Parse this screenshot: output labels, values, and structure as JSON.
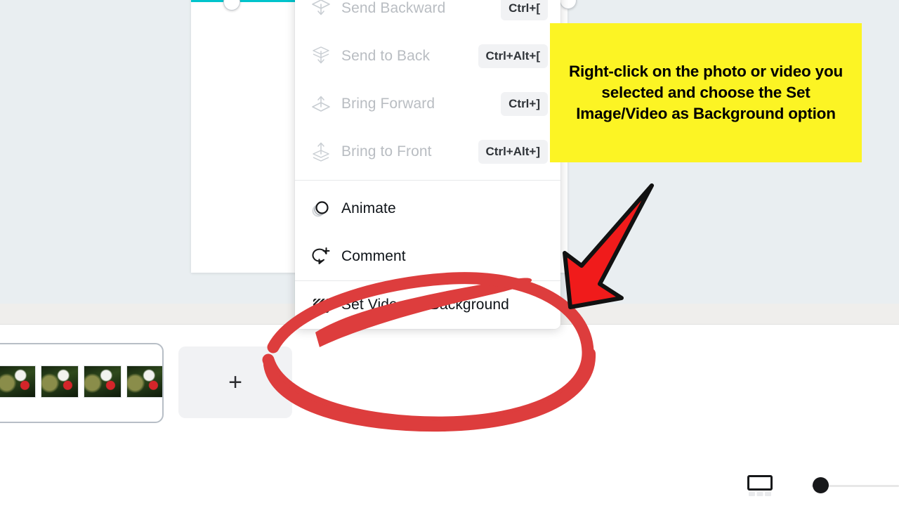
{
  "app": {
    "name": "canva-editor",
    "canvas_background_color": "#e9eef1",
    "selection_color": "#00c4cc"
  },
  "context_menu": {
    "items": [
      {
        "label": "Send Backward",
        "shortcut": "Ctrl+[",
        "icon": "send-backward-icon",
        "disabled": true
      },
      {
        "label": "Send to Back",
        "shortcut": "Ctrl+Alt+[",
        "icon": "send-to-back-icon",
        "disabled": true
      },
      {
        "label": "Bring Forward",
        "shortcut": "Ctrl+]",
        "icon": "bring-forward-icon",
        "disabled": true
      },
      {
        "label": "Bring to Front",
        "shortcut": "Ctrl+Alt+]",
        "icon": "bring-to-front-icon",
        "disabled": true
      },
      {
        "label": "Animate",
        "shortcut": "",
        "icon": "animate-icon",
        "disabled": false
      },
      {
        "label": "Comment",
        "shortcut": "",
        "icon": "comment-add-icon",
        "disabled": false
      },
      {
        "label": "Set Video as Background",
        "shortcut": "",
        "icon": "hatch-pattern-icon",
        "disabled": false
      }
    ]
  },
  "timeline": {
    "add_page_label": "+",
    "clip_thumbnail_count": 5
  },
  "footer": {
    "grid_view_icon": "page-grid-icon",
    "zoom_slider_icon": "zoom-slider-handle",
    "zoom_value": 0
  },
  "annotation": {
    "callout_text": "Right-click on the photo or video you selected and choose the Set Image/Video as Background option",
    "callout_background": "#fcf424",
    "callout_text_color": "#000000",
    "arrow_color": "#f01b1b",
    "arrow_outline_color": "#111111",
    "circle_color": "#dd3d3d"
  }
}
